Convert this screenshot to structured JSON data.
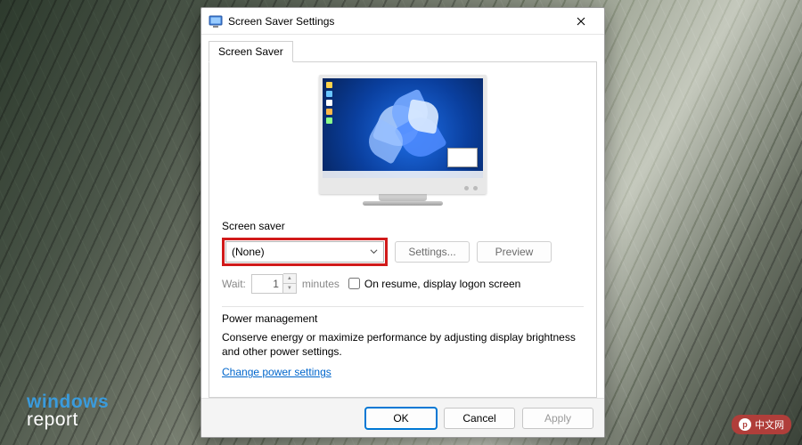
{
  "window": {
    "title": "Screen Saver Settings",
    "tab_label": "Screen Saver"
  },
  "screensaver": {
    "group_label": "Screen saver",
    "selected": "(None)",
    "settings_btn": "Settings...",
    "preview_btn": "Preview"
  },
  "wait": {
    "label": "Wait:",
    "value": "1",
    "unit": "minutes",
    "resume_label": "On resume, display logon screen"
  },
  "power": {
    "group_label": "Power management",
    "text": "Conserve energy or maximize performance by adjusting display brightness and other power settings.",
    "link": "Change power settings"
  },
  "buttons": {
    "ok": "OK",
    "cancel": "Cancel",
    "apply": "Apply"
  },
  "branding": {
    "wr1": "windows",
    "wr2": "report",
    "php": "中文网"
  }
}
